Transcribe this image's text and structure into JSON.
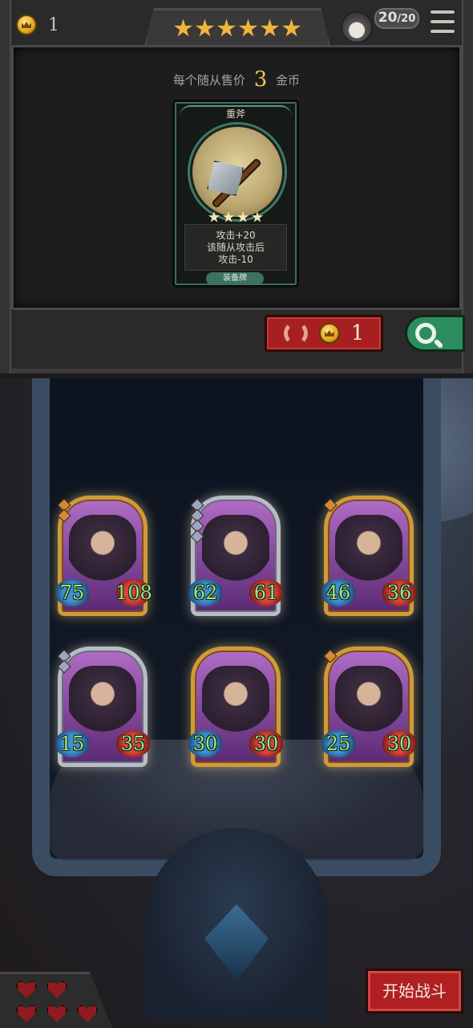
{
  "top": {
    "gold": "1",
    "shop_level_stars": 6,
    "turn": {
      "current": "20",
      "separator": "/",
      "max": "20"
    }
  },
  "shop": {
    "sell_prefix": "每个随从售价",
    "sell_value": "3",
    "sell_suffix": "金币",
    "card": {
      "name": "重斧",
      "stars": 4,
      "desc_line1": "攻击+20",
      "desc_line2": "该随从攻击后",
      "desc_line3": "攻击-10",
      "type": "装备牌"
    },
    "refresh_cost": "1"
  },
  "board": {
    "units": [
      {
        "atk": "75",
        "hp": "108",
        "rank": 2,
        "frame": "gold"
      },
      {
        "atk": "62",
        "hp": "61",
        "rank": 4,
        "frame": "silver"
      },
      {
        "atk": "46",
        "hp": "36",
        "rank": 1,
        "frame": "gold"
      },
      {
        "atk": "15",
        "hp": "35",
        "rank": 2,
        "frame": "silver"
      },
      {
        "atk": "30",
        "hp": "30",
        "rank": 0,
        "frame": "gold"
      },
      {
        "atk": "25",
        "hp": "30",
        "rank": 1,
        "frame": "gold"
      }
    ]
  },
  "bottom": {
    "lives": 5,
    "start_label": "开始战斗"
  }
}
